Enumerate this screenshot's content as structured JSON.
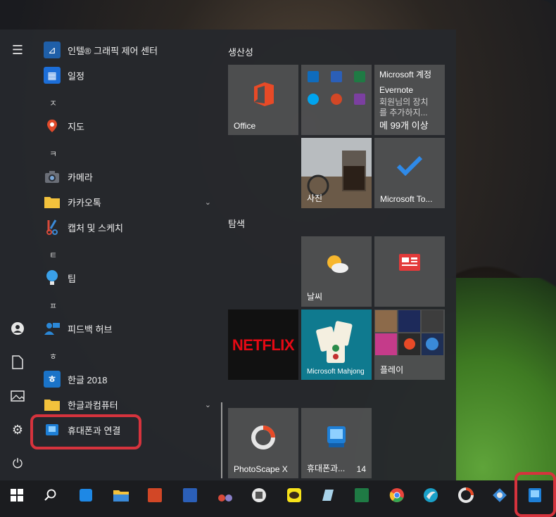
{
  "start_menu": {
    "app_list": [
      {
        "kind": "app",
        "label": "인텔® 그래픽 제어 센터",
        "icon": "intel-graphics-icon"
      },
      {
        "kind": "app",
        "label": "일정",
        "icon": "calendar-icon"
      },
      {
        "kind": "letter",
        "label": "ㅈ"
      },
      {
        "kind": "app",
        "label": "지도",
        "icon": "maps-icon"
      },
      {
        "kind": "letter",
        "label": "ㅋ"
      },
      {
        "kind": "app",
        "label": "카메라",
        "icon": "camera-icon"
      },
      {
        "kind": "folder",
        "label": "카카오톡",
        "icon": "folder-icon"
      },
      {
        "kind": "app",
        "label": "캡처 및 스케치",
        "icon": "snip-sketch-icon"
      },
      {
        "kind": "letter",
        "label": "ㅌ"
      },
      {
        "kind": "app",
        "label": "팁",
        "icon": "tips-icon"
      },
      {
        "kind": "letter",
        "label": "ㅍ"
      },
      {
        "kind": "app",
        "label": "피드백 허브",
        "icon": "feedback-hub-icon"
      },
      {
        "kind": "letter",
        "label": "ㅎ"
      },
      {
        "kind": "app",
        "label": "한글 2018",
        "icon": "hangul-icon"
      },
      {
        "kind": "folder",
        "label": "한글과컴퓨터",
        "icon": "folder-icon"
      },
      {
        "kind": "app",
        "label": "휴대폰과 연결",
        "icon": "your-phone-icon"
      }
    ],
    "groups": {
      "productivity": "생산성",
      "explore": "탐색"
    },
    "tiles": {
      "office": "Office",
      "microsoft_account": "Microsoft 계정",
      "evernote_title": "Evernote",
      "evernote_desc1": "회원님의 장치",
      "evernote_desc2": "를 추가하지...",
      "evernote_footer": "메 99개 이상",
      "photos": "사진",
      "todo": "Microsoft To...",
      "weather": "날씨",
      "netflix": "NETFLIX",
      "mahjong": "Microsoft Mahjong",
      "play": "플레이",
      "photoscape": "PhotoScape X",
      "your_phone": "휴대폰과...",
      "your_phone_badge": "14"
    }
  },
  "colors": {
    "highlight": "#d6333d",
    "accent": "#0078d7",
    "netflix_red": "#e50914"
  }
}
